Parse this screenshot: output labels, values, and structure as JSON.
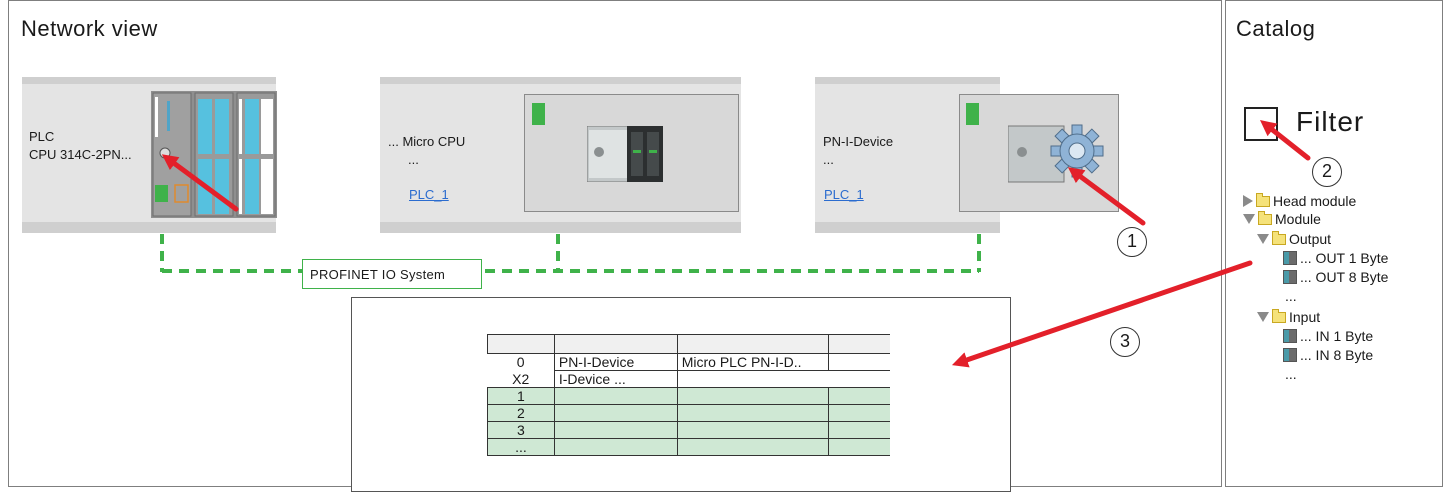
{
  "network_view": {
    "title": "Network view",
    "devices": [
      {
        "line1": "PLC",
        "line2": "CPU 314C-2PN..."
      },
      {
        "line1": "... Micro CPU",
        "line2": "...",
        "link": "PLC_1"
      },
      {
        "line1": "PN-I-Device",
        "line2": "...",
        "link": "PLC_1"
      }
    ],
    "network_label": "PROFINET IO System",
    "table": {
      "rows": [
        {
          "slot": "0",
          "module": "PN-I-Device",
          "type": "Micro PLC PN-I-D..",
          "extra": ""
        },
        {
          "slot": "X2",
          "module": "I-Device ...",
          "type": "",
          "extra": ""
        },
        {
          "slot": "1",
          "module": "",
          "type": "",
          "extra": ""
        },
        {
          "slot": "2",
          "module": "",
          "type": "",
          "extra": ""
        },
        {
          "slot": "3",
          "module": "",
          "type": "",
          "extra": ""
        },
        {
          "slot": "...",
          "module": "",
          "type": "",
          "extra": ""
        }
      ]
    }
  },
  "catalog": {
    "title": "Catalog",
    "filter_label": "Filter",
    "tree": [
      {
        "label": "Head module"
      },
      {
        "label": "Module"
      },
      {
        "label": "Output"
      },
      {
        "label": "... OUT 1 Byte"
      },
      {
        "label": "... OUT 8 Byte"
      },
      {
        "label": "..."
      },
      {
        "label": "Input"
      },
      {
        "label": "... IN 1 Byte"
      },
      {
        "label": "... IN 8 Byte"
      },
      {
        "label": "..."
      }
    ]
  },
  "callouts": [
    "1",
    "2",
    "3"
  ],
  "colors": {
    "accent_arrow": "#e3202a",
    "status_green": "#3fb24a",
    "network_line": "#3fb24a",
    "slot_row": "#cfe8d4"
  }
}
